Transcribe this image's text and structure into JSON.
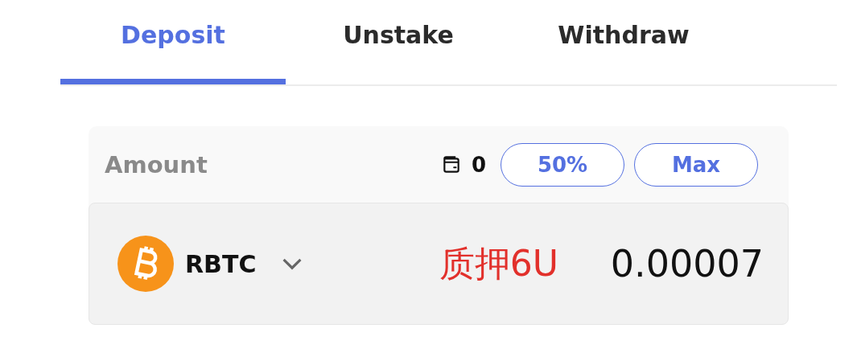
{
  "tabs": [
    {
      "label": "Deposit",
      "selected": true
    },
    {
      "label": "Unstake",
      "selected": false
    },
    {
      "label": "Withdraw",
      "selected": false
    }
  ],
  "amount": {
    "label": "Amount",
    "balance": "0",
    "buttons": [
      "50%",
      "Max"
    ]
  },
  "token": {
    "symbol": "RBTC",
    "value": "0.00007"
  },
  "annotation": "质押6U"
}
